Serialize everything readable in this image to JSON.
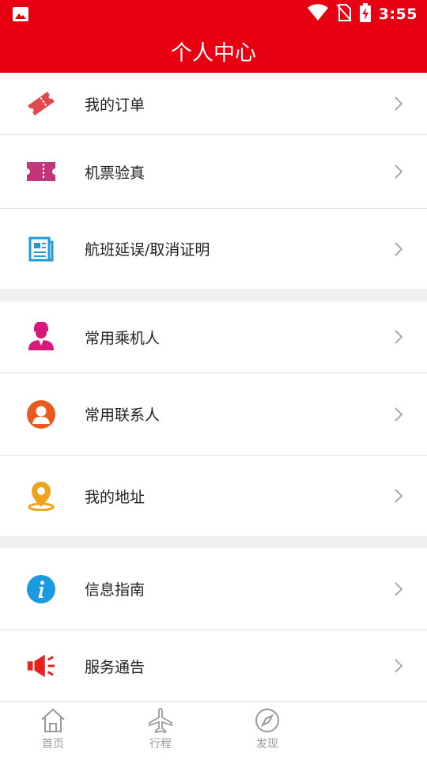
{
  "status": {
    "time": "3:55"
  },
  "header": {
    "title": "个人中心"
  },
  "menu": [
    {
      "label": "我的订单"
    },
    {
      "label": "机票验真"
    },
    {
      "label": "航班延误/取消证明"
    },
    {
      "label": "常用乘机人"
    },
    {
      "label": "常用联系人"
    },
    {
      "label": "我的地址"
    },
    {
      "label": "信息指南"
    },
    {
      "label": "服务通告"
    }
  ],
  "tabbar": {
    "tabs": [
      {
        "label": "首页"
      },
      {
        "label": "行程"
      },
      {
        "label": "发现"
      }
    ]
  },
  "colors": {
    "brand": "#e60012",
    "order_icon": "#e0484e",
    "verify_icon": "#c2357a",
    "proof_icon": "#1e9bd7",
    "passenger_icon": "#d6197a",
    "contact_icon": "#e85a1e",
    "address_icon": "#f0a11e",
    "info_icon": "#1a9be0",
    "notice_icon": "#e8211c"
  }
}
